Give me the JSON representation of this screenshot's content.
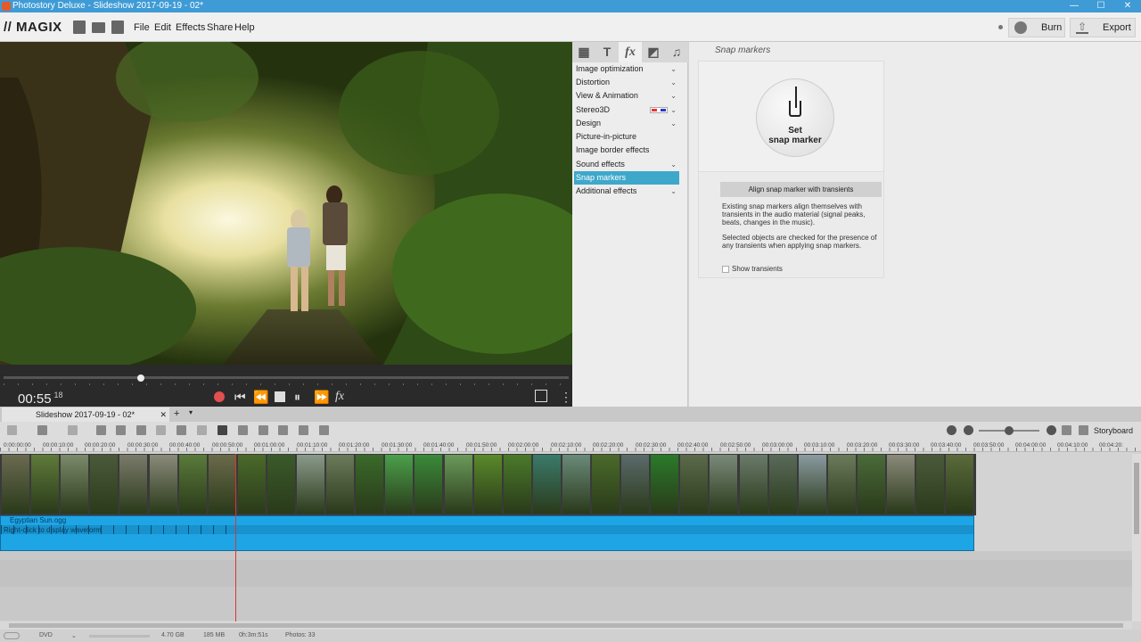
{
  "window": {
    "title": "Photostory Deluxe - Slideshow 2017-09-19 - 02*",
    "minimize": "—",
    "maximize": "☐",
    "close": "✕"
  },
  "menu": {
    "logo": "MAGIX",
    "items": [
      "File",
      "Edit",
      "Effects",
      "Share",
      "Help"
    ]
  },
  "toolbar_right": {
    "burn": "Burn",
    "export": "Export"
  },
  "preview": {
    "description_colors": {
      "light": "#f6f2d8",
      "foliage": "#3e5a1e",
      "dark": "#1e2a10"
    }
  },
  "transport": {
    "timecode": "00:55",
    "frames": "18"
  },
  "effects_tabs": [
    "▦",
    "T",
    "fx",
    "◩",
    "♫"
  ],
  "effects_list": [
    {
      "label": "Image optimization",
      "chev": "⌄"
    },
    {
      "label": "Distortion",
      "chev": "⌄"
    },
    {
      "label": "View & Animation",
      "chev": "⌄"
    },
    {
      "label": "Stereo3D",
      "chev": "⌄"
    },
    {
      "label": "Design",
      "chev": "⌄"
    },
    {
      "label": "Picture-in-picture",
      "chev": ""
    },
    {
      "label": "Image border effects",
      "chev": ""
    },
    {
      "label": "Sound effects",
      "chev": "⌄"
    },
    {
      "label": "Snap markers",
      "chev": ""
    },
    {
      "label": "Additional effects",
      "chev": "⌄"
    }
  ],
  "snap_panel": {
    "title": "Snap markers",
    "set_line1": "Set",
    "set_line2": "snap marker",
    "align_button": "Align snap marker with transients",
    "text1": "Existing snap markers align themselves with transients in the audio material (signal peaks, beats, changes in the music).",
    "text2": "Selected objects are checked for the presence of any transients when applying snap markers.",
    "show_transients": "Show transients"
  },
  "timeline": {
    "project_tab": "Slideshow 2017-09-19 - 02*",
    "tab_close": "✕",
    "add_tab": "+",
    "storyboard": "Storyboard",
    "ruler_labels": [
      "0:00:00:00",
      "00:00:10:00",
      "00:00:20:00",
      "00:00:30:00",
      "00:00:40:00",
      "00:00:50:00",
      "00:01:00:00",
      "00:01:10:00",
      "00:01:20:00",
      "00:01:30:00",
      "00:01:40:00",
      "00:01:50:00",
      "00:02:00:00",
      "00:02:10:00",
      "00:02:20:00",
      "00:02:30:00",
      "00:02:40:00",
      "00:02:50:00",
      "00:03:00:00",
      "00:03:10:00",
      "00:03:20:00",
      "00:03:30:00",
      "00:03:40:00",
      "00:03:50:00",
      "00:04:00:00",
      "00:04:10:00",
      "00:04:20:"
    ],
    "audio_name": "Egyptian Sun.ogg",
    "audio_hint": "Right-click to display waveform"
  },
  "thumb_colors": [
    "#6a6a50",
    "#5e7a3a",
    "#7a8a6a",
    "#4a5a3a",
    "#7a7a6a",
    "#8a8a7a",
    "#5a7a3a",
    "#6a6a4a",
    "#4a6a2a",
    "#3a5a2a",
    "#8a9a8a",
    "#6a7a5a",
    "#3a6a2a",
    "#4aa04a",
    "#3a8a3a",
    "#6a9a5a",
    "#5a8a2a",
    "#4a7a2a",
    "#3a7a6a",
    "#6a8a7a",
    "#4a6a2a",
    "#5a6a6a",
    "#2a7a2a",
    "#5a6a4a",
    "#7a8a7a",
    "#6a7a6a",
    "#5a6a5a",
    "#8a9aa0",
    "#6a7a5a",
    "#4a6a3a",
    "#8a8a7a",
    "#4a5a3a",
    "#5a6a3a"
  ],
  "status": {
    "format": "DVD",
    "size": "4.70 GB",
    "used": "185 MB",
    "duration": "0h:3m:51s",
    "photos": "Photos: 33"
  }
}
